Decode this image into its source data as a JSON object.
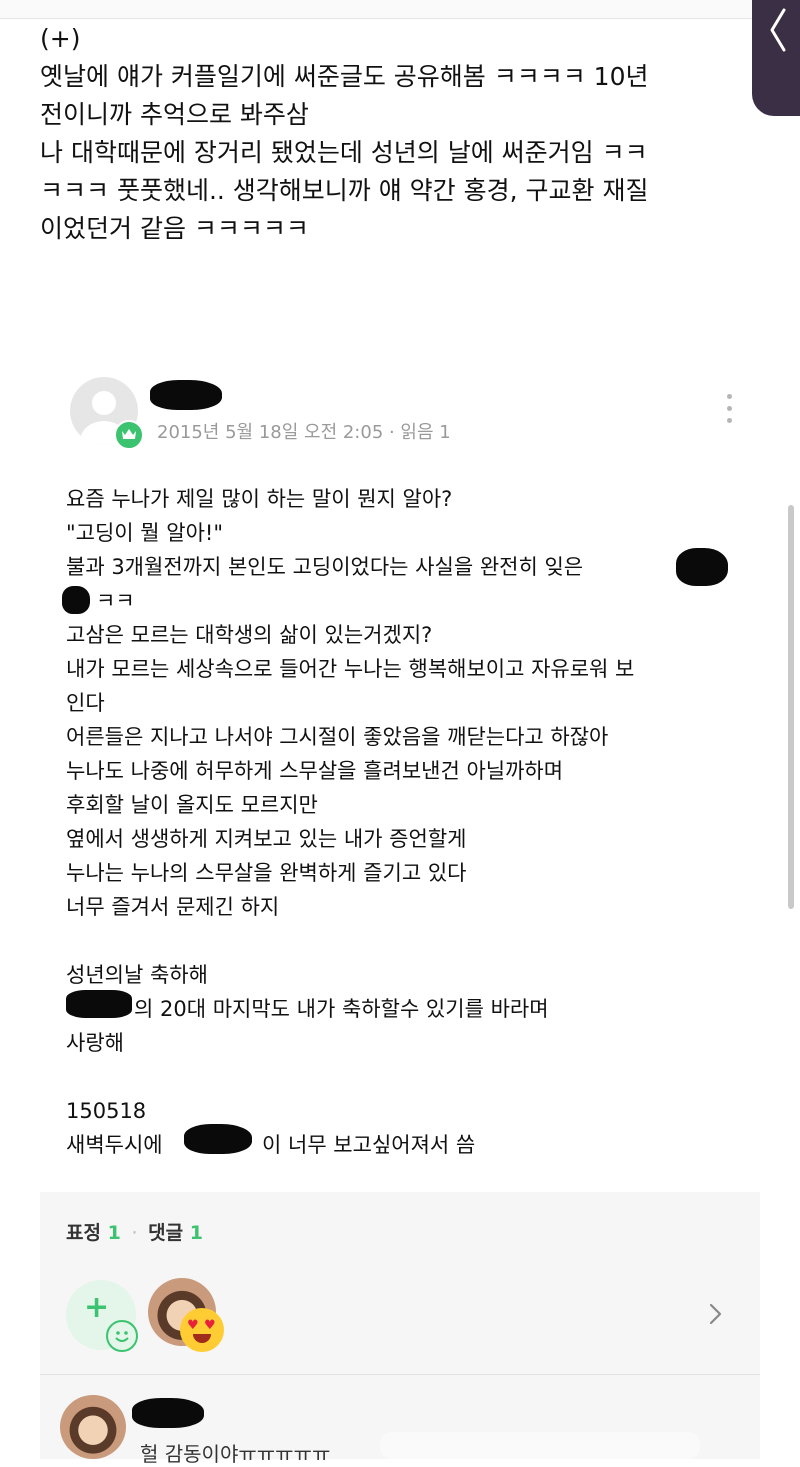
{
  "intro": {
    "lines": [
      "(+)",
      "옛날에 얘가 커플일기에 써준글도 공유해봄 ㅋㅋㅋㅋ 10년",
      "전이니까 추억으로 봐주삼",
      "나 대학때문에 장거리 됐었는데 성년의 날에 써준거임 ㅋㅋ",
      "ㅋㅋㅋ 풋풋했네.. 생각해보니까 얘 약간 홍경, 구교환 재질",
      "이었던거 같음 ㅋㅋㅋㅋㅋ"
    ]
  },
  "post": {
    "meta": "2015년 5월 18일 오전 2:05 · 읽음 1",
    "lines": [
      "요즘 누나가 제일 많이 하는 말이 뭔지 알아?",
      "\"고딩이 뭘 알아!\"",
      "불과 3개월전까지 본인도 고딩이었다는 사실을 완전히 잊은",
      "ㅋㅋ",
      "고삼은 모르는 대학생의 삶이 있는거겠지?",
      "내가 모르는 세상속으로 들어간 누나는 행복해보이고 자유로워 보",
      "인다",
      "어른들은 지나고 나서야 그시절이 좋았음을 깨닫는다고 하잖아",
      "누나도 나중에 허무하게 스무살을 흘려보낸건 아닐까하며",
      "후회할 날이 올지도 모르지만",
      "옆에서 생생하게 지켜보고 있는 내가 증언할게",
      "누나는 누나의 스무살을 완벽하게 즐기고 있다",
      "너무 즐겨서 문제긴 하지",
      "",
      "성년의날 축하해",
      "의 20대 마지막도 내가 축하할수 있기를 바라며",
      "사랑해",
      "",
      "150518",
      "새벽두시에",
      "이 너무 보고싶어져서 씀"
    ]
  },
  "reactions": {
    "label_emotion": "표정",
    "emotion_count": "1",
    "separator": "·",
    "label_comment": "댓글",
    "comment_count": "1"
  },
  "comment": {
    "text": "헐 감동이야ㅠㅠㅠㅠㅠ"
  },
  "colors": {
    "accent_green": "#3cc36f",
    "side_tab": "#3b2f45"
  }
}
